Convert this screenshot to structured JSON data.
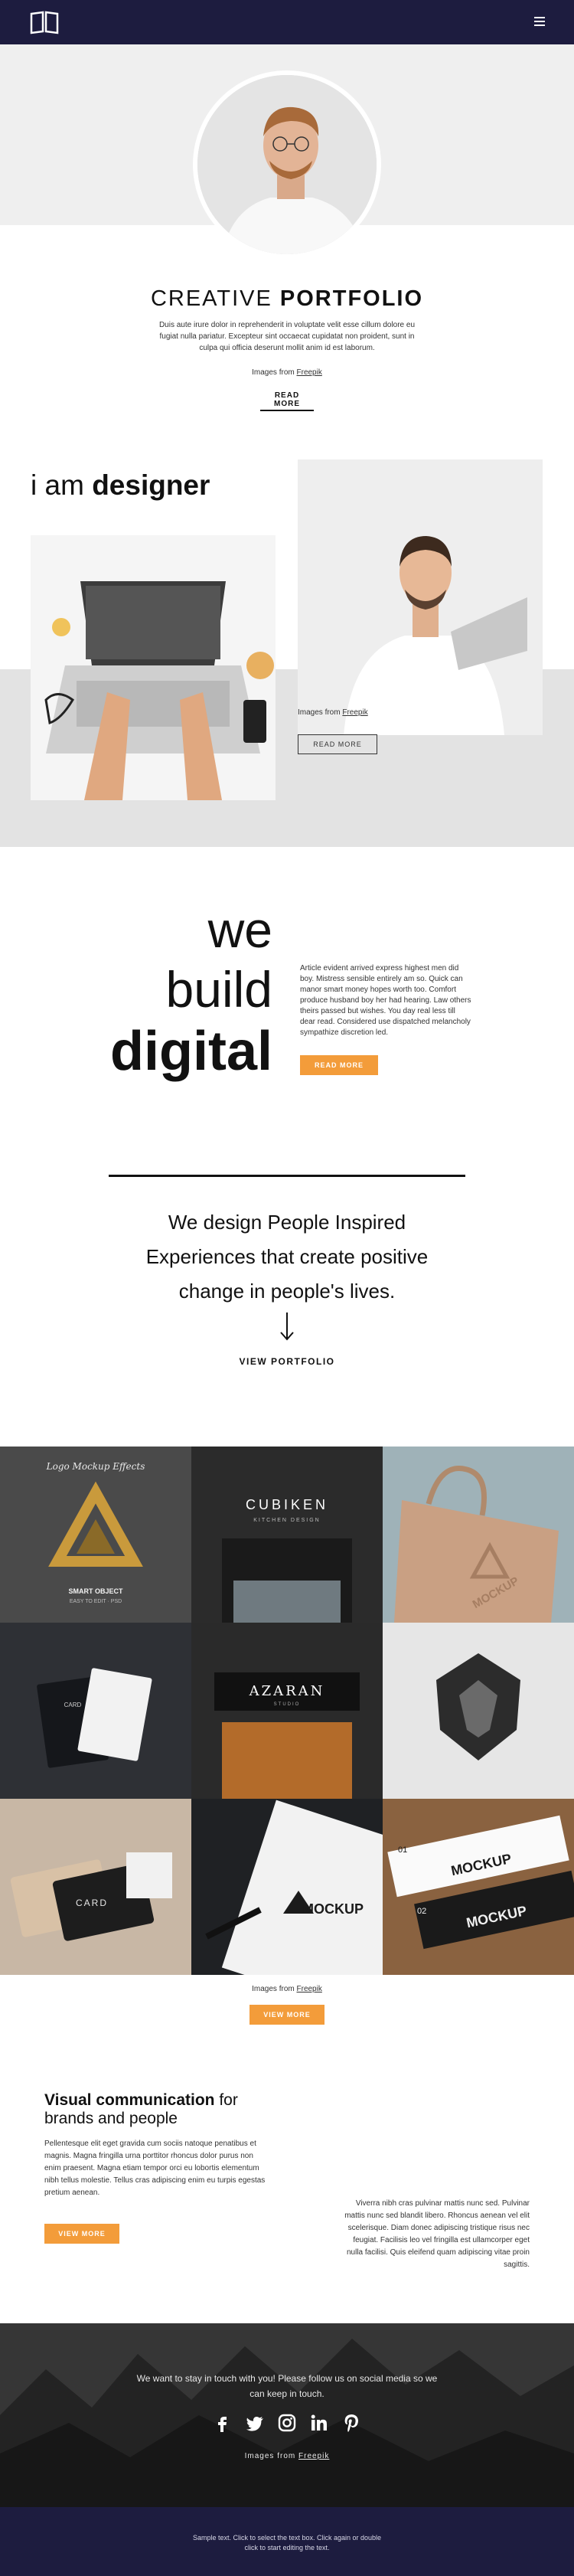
{
  "header": {
    "logo_icon": "book-icon",
    "menu_icon": "hamburger-icon",
    "bg_color": "#1d1c3f"
  },
  "hero": {
    "title_light": "CREATIVE",
    "title_bold": "PORTFOLIO",
    "text": "Duis aute irure dolor in reprehenderit in voluptate velit esse cillum dolore eu fugiat nulla pariatur. Excepteur sint occaecat cupidatat non proident, sunt in culpa qui officia deserunt mollit anim id est laborum.",
    "credit_prefix": "Images from ",
    "credit_link": "Freepik",
    "read_more": "READ MORE"
  },
  "designer": {
    "title_light": "i am",
    "title_bold": "designer",
    "credit_prefix": "Images from ",
    "credit_link": "Freepik",
    "read_more": "READ MORE"
  },
  "build": {
    "line1": "we",
    "line2": "build",
    "line3": "digital",
    "text": "Article evident arrived express highest men did boy. Mistress sensible entirely am so. Quick can manor smart money hopes worth too. Comfort produce husband boy her had hearing. Law others theirs passed but wishes. You day real less till dear read. Considered use dispatched melancholy sympathize discretion led.",
    "button": "READ MORE"
  },
  "statement": {
    "text": "We design People Inspired Experiences that create positive change in people's lives.",
    "arrow_icon": "arrow-down-icon",
    "link": "VIEW PORTFOLIO"
  },
  "gallery": {
    "tiles": [
      {
        "caption1": "Logo Mockup Effects",
        "caption2": "SMART OBJECT",
        "caption3": "EASY TO EDIT · PSD"
      },
      {
        "caption1": "CUBIKEN",
        "caption2": "KITCHEN DESIGN"
      },
      {
        "caption1": "MOCKUP"
      },
      {
        "caption1": "CARD"
      },
      {
        "caption1": "AZARAN",
        "caption2": "STUDIO"
      },
      {
        "caption1": ""
      },
      {
        "caption1": "CARD"
      },
      {
        "caption1": "MOCKUP"
      },
      {
        "caption1": "MOCKUP",
        "caption2": "01",
        "caption3": "02"
      }
    ],
    "credit_prefix": "Images from ",
    "credit_link": "Freepik",
    "button": "VIEW MORE"
  },
  "visual": {
    "title_bold": "Visual communication",
    "title_light1": " for",
    "title_light2": "brands and people",
    "left_text": "Pellentesque elit eget gravida cum sociis natoque penatibus et magnis. Magna fringilla urna porttitor rhoncus dolor purus non enim praesent. Magna etiam tempor orci eu lobortis elementum nibh tellus molestie. Tellus cras adipiscing enim eu turpis egestas pretium aenean.",
    "button": "VIEW MORE",
    "right_text": "Viverra nibh cras pulvinar mattis nunc sed. Pulvinar mattis nunc sed blandit libero. Rhoncus aenean vel elit scelerisque. Diam donec adipiscing tristique risus nec feugiat. Facilisis leo vel fringilla est ullamcorper eget nulla facilisi. Quis eleifend quam adipiscing vitae proin sagittis."
  },
  "social": {
    "text": "We want to stay in touch with you! Please follow us on social media so we can keep in touch.",
    "icons": [
      "facebook-icon",
      "twitter-icon",
      "instagram-icon",
      "linkedin-icon",
      "pinterest-icon"
    ],
    "credit_prefix": "Images from ",
    "credit_link": "Freepik"
  },
  "footer": {
    "text": "Sample text. Click to select the text box. Click again or double click to start editing the text."
  },
  "colors": {
    "accent": "#f39c3a",
    "dark": "#1d1c3f"
  }
}
